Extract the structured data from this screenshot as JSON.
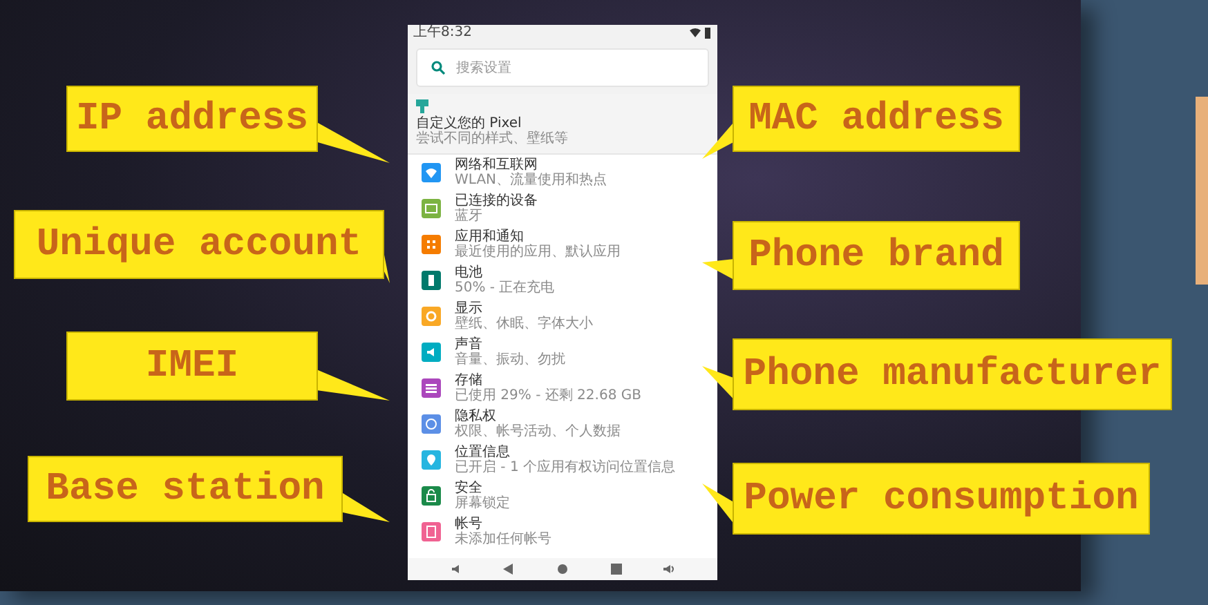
{
  "phone": {
    "status_bar": {
      "time": "上午8:32"
    },
    "search": {
      "placeholder": "搜索设置"
    },
    "suggestion": {
      "title": "自定义您的 Pixel",
      "subtitle": "尝试不同的样式、壁纸等"
    },
    "settings": [
      {
        "kind": "wifi",
        "title": "网络和互联网",
        "subtitle": "WLAN、流量使用和热点",
        "color": "#2196f3"
      },
      {
        "kind": "devices",
        "title": "已连接的设备",
        "subtitle": "蓝牙",
        "color": "#7cb342"
      },
      {
        "kind": "apps",
        "title": "应用和通知",
        "subtitle": "最近使用的应用、默认应用",
        "color": "#f57c00"
      },
      {
        "kind": "battery",
        "title": "电池",
        "subtitle": "50% - 正在充电",
        "color": "#00796b"
      },
      {
        "kind": "display",
        "title": "显示",
        "subtitle": "壁纸、休眠、字体大小",
        "color": "#f9a825"
      },
      {
        "kind": "sound",
        "title": "声音",
        "subtitle": "音量、振动、勿扰",
        "color": "#00acc1"
      },
      {
        "kind": "storage",
        "title": "存储",
        "subtitle": "已使用 29% - 还剩 22.68 GB",
        "color": "#ab47bc"
      },
      {
        "kind": "privacy",
        "title": "隐私权",
        "subtitle": "权限、帐号活动、个人数据",
        "color": "#5c8fe6"
      },
      {
        "kind": "location",
        "title": "位置信息",
        "subtitle": "已开启 - 1 个应用有权访问位置信息",
        "color": "#26b5e0"
      },
      {
        "kind": "security",
        "title": "安全",
        "subtitle": "屏幕锁定",
        "color": "#1b8a4a"
      },
      {
        "kind": "account",
        "title": "帐号",
        "subtitle": "未添加任何帐号",
        "color": "#f06292"
      }
    ]
  },
  "callouts": [
    {
      "label": "IP address"
    },
    {
      "label": "Unique account"
    },
    {
      "label": "IMEI"
    },
    {
      "label": "Base station"
    },
    {
      "label": "MAC address"
    },
    {
      "label": "Phone brand"
    },
    {
      "label": "Phone manufacturer"
    },
    {
      "label": "Power consumption"
    }
  ]
}
